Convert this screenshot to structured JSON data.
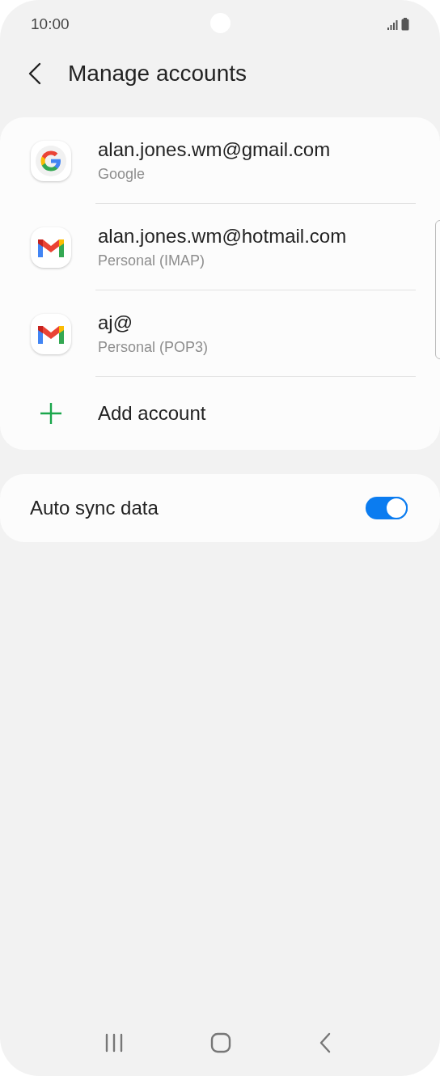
{
  "status_bar": {
    "time": "10:00"
  },
  "header": {
    "title": "Manage accounts"
  },
  "accounts": [
    {
      "kind": "google",
      "email": "alan.jones.wm@gmail.com",
      "type": "Google"
    },
    {
      "kind": "gmail",
      "email": "alan.jones.wm@hotmail.com",
      "type": "Personal (IMAP)"
    },
    {
      "kind": "gmail",
      "email": "aj@",
      "type": "Personal (POP3)"
    }
  ],
  "add_account": {
    "label": "Add account"
  },
  "auto_sync": {
    "label": "Auto sync data",
    "on": true
  }
}
